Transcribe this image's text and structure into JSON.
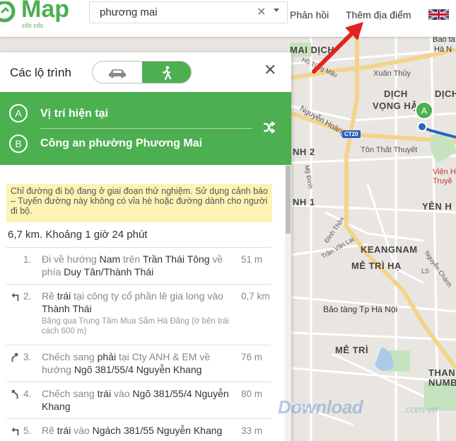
{
  "header": {
    "logo_text": "Map",
    "logo_sub": "cốc cốc",
    "search_value": "phương mai",
    "feedback_label": "Phản hồi",
    "add_place_label": "Thêm địa điểm",
    "language": "English (UK flag)"
  },
  "colors": {
    "brand_green": "#4caf50",
    "route_blue": "#2a62c4",
    "warning_bg": "#fdf3b4",
    "annotation_red": "#e32222"
  },
  "route_panel": {
    "title": "Các lộ trình",
    "modes": [
      {
        "name": "car",
        "icon": "car-icon",
        "selected": false
      },
      {
        "name": "walk",
        "icon": "walk-icon",
        "selected": true
      }
    ],
    "waypoints": [
      {
        "letter": "A",
        "label": "Vị trí hiện tại"
      },
      {
        "letter": "B",
        "label": "Công an phường Phương Mai"
      }
    ],
    "warning": "Chỉ đường đi bộ đang ở giai đoạn thử nghiệm. Sử dụng cảnh báo – Tuyến đường này không có vỉa hè hoặc đường dành cho người đi bộ.",
    "summary": "6,7 km. Khoảng 1 giờ 24 phút",
    "steps": [
      {
        "num": "1.",
        "icon": "none",
        "parts": [
          "Đi về hướng ",
          "Nam",
          " trên ",
          "Trần Thái Tông",
          " về phía ",
          "Duy Tân/Thành Thái"
        ],
        "note": "",
        "distance": "51 m"
      },
      {
        "num": "2.",
        "icon": "turn-left-icon",
        "parts": [
          "Rẽ ",
          "trái",
          " tại công ty cổ phần lê gia long vào ",
          "Thành Thái"
        ],
        "note": "Băng qua Trung Tâm Mua Sắm Hà Đăng (ở bên trái cách 600 m)",
        "distance": "0,7 km"
      },
      {
        "num": "3.",
        "icon": "slight-right-icon",
        "parts": [
          "Chếch sang ",
          "phải",
          " tại Cty ANH & EM về hướng ",
          "Ngõ 381/55/4 Nguyễn Khang"
        ],
        "note": "",
        "distance": "76 m"
      },
      {
        "num": "4.",
        "icon": "slight-left-icon",
        "parts": [
          "Chếch sang ",
          "trái",
          " vào ",
          "Ngõ 381/55/4 Nguyễn Khang"
        ],
        "note": "",
        "distance": "80 m"
      },
      {
        "num": "5.",
        "icon": "turn-left-icon",
        "parts": [
          "Rẽ ",
          "trái",
          " vào ",
          "Ngách 381/55 Nguyễn Khang"
        ],
        "note": "",
        "distance": "33 m"
      }
    ]
  },
  "map": {
    "labels": {
      "mai_dich": "MAI DỊCH",
      "dich_vong_hau": "DỊCH\nVỌNG HẬU",
      "dich_vong_hau_1": "DỊCH",
      "dich_vong_hau_2": "VỌNG HẬU",
      "dich_partial": "DỊCH",
      "keangnam": "KEANGNAM",
      "me_tri_ha": "MỄ TRÌ HẠ",
      "me_tri": "MỄ TRÌ",
      "yen_hoa": "YÊN H",
      "nh2": "NH 2",
      "nh1": "NH 1",
      "museum": "Bảo tàng Tp Hà Nội",
      "bao_tang": "Bao tà",
      "ha_noi": "Hà N",
      "vien_h": "Viện H",
      "truyen": "Truyề",
      "xuan_thuy": "Xuân Thủy",
      "ton_that_thuyet": "Tôn Thất Thuyết",
      "nguyen_hoang": "Nguyễn Hoàng",
      "ho_tung_mau": "Hồ Tùng Mậu",
      "my_dinh": "Mỹ Đình",
      "dinh_thon": "Đình Thôn",
      "tran_van_lai": "Trần Văn Lai",
      "nguyen_chanh": "Nguyễn Chánh",
      "ls": "LS",
      "thanh_nam": "THANH",
      "numb": "NUMB",
      "ct20": "CT20"
    },
    "marker_letter": "A"
  },
  "watermark": {
    "text": "Download",
    "suffix": ".com.vn"
  }
}
